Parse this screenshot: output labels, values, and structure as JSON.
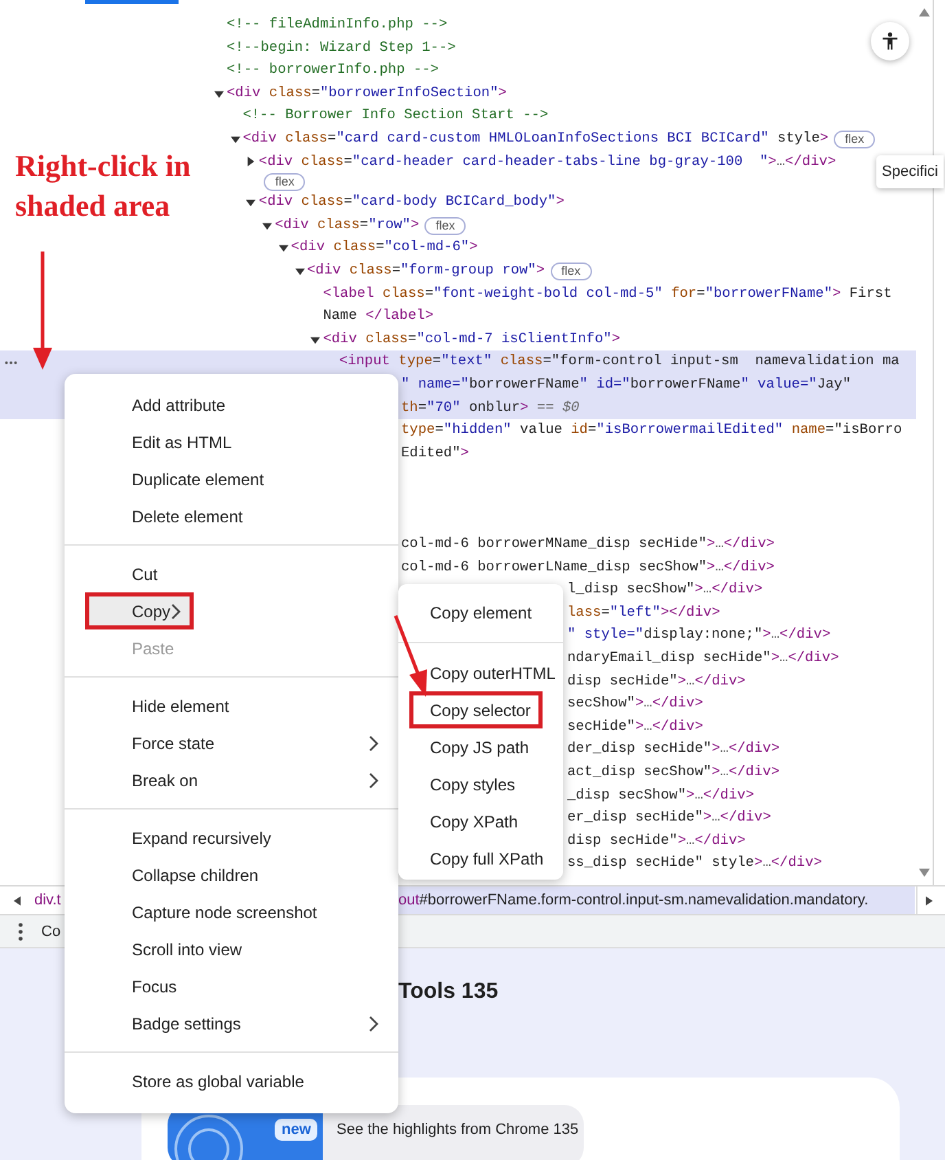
{
  "annotation": {
    "text": "Right-click in shaded area"
  },
  "code_tree": [
    {
      "kind": "comment",
      "selected": false,
      "lines": [
        {
          "text": "<!-- fileAdminInfo.php -->"
        }
      ]
    },
    {
      "kind": "comment",
      "selected": false,
      "lines": [
        {
          "text": "<!--begin: Wizard Step 1-->"
        }
      ]
    },
    {
      "kind": "comment",
      "selected": false,
      "lines": [
        {
          "text": "<!-- borrowerInfo.php -->"
        }
      ]
    },
    {
      "kind": "element",
      "selected": false,
      "expanded": true,
      "lines": [
        {
          "text": "<div class=\"borrowerInfoSection\">"
        }
      ],
      "children": [
        {
          "kind": "comment",
          "selected": false,
          "lines": [
            {
              "text": "<!-- Borrower Info Section Start -->"
            }
          ]
        },
        {
          "kind": "element",
          "selected": false,
          "expanded": true,
          "badge": "flex",
          "lines": [
            {
              "text": "<div class=\"card card-custom HMLOLoanInfoSections BCI BCICard\" style>"
            }
          ],
          "children": [
            {
              "kind": "element",
              "selected": false,
              "expanded": false,
              "badge": "flex",
              "lines": [
                {
                  "text": "<div class=\"card-header card-header-tabs-line bg-gray-100  \">…</div>"
                }
              ]
            },
            {
              "kind": "element",
              "selected": false,
              "expanded": true,
              "lines": [
                {
                  "text": "<div class=\"card-body BCICard_body\">"
                }
              ],
              "children": [
                {
                  "kind": "element",
                  "selected": false,
                  "expanded": true,
                  "badge": "flex",
                  "lines": [
                    {
                      "text": "<div class=\"row\">"
                    }
                  ],
                  "children": [
                    {
                      "kind": "element",
                      "selected": false,
                      "expanded": true,
                      "lines": [
                        {
                          "text": "<div class=\"col-md-6\">"
                        }
                      ],
                      "children": [
                        {
                          "kind": "element",
                          "selected": false,
                          "expanded": true,
                          "badge": "flex",
                          "lines": [
                            {
                              "text": "<div class=\"form-group row\">"
                            }
                          ],
                          "children": [
                            {
                              "kind": "leaf",
                              "selected": false,
                              "lines": [
                                {
                                  "text": "<label class=\"font-weight-bold col-md-5\" for=\"borrowerFName\"> First"
                                },
                                {
                                  "text": "Name </label>"
                                }
                              ]
                            },
                            {
                              "kind": "element",
                              "selected": false,
                              "expanded": true,
                              "lines": [
                                {
                                  "text": "<div class=\"col-md-7 isClientInfo\">"
                                }
                              ],
                              "children": [
                                {
                                  "kind": "leaf",
                                  "selected": true,
                                  "lines": [
                                    {
                                      "text": "<input type=\"text\" class=\"form-control input-sm  namevalidation ma"
                                    },
                                    {
                                      "text": "\" name=\"borrowerFName\" id=\"borrowerFName\" value=\"Jay\"",
                                      "kind": "after_menu"
                                    },
                                    {
                                      "text": "th=\"70\" onblur> == $0",
                                      "kind": "after_menu"
                                    }
                                  ]
                                },
                                {
                                  "kind": "leaf",
                                  "selected": false,
                                  "lines": [
                                    {
                                      "text": "type=\"hidden\" value id=\"isBorrowermailEdited\" name=\"isBorro",
                                      "kind": "after_menu"
                                    },
                                    {
                                      "text": "Edited\">",
                                      "kind": "after_menu"
                                    }
                                  ]
                                }
                              ]
                            }
                          ]
                        }
                      ]
                    },
                    {
                      "kind": "leaf",
                      "selected": false,
                      "lines": [
                        {
                          "text": "col-md-6 borrowerMName_disp secHide\">…</div>",
                          "kind": "after_menu"
                        }
                      ]
                    },
                    {
                      "kind": "leaf",
                      "selected": false,
                      "lines": [
                        {
                          "text": "col-md-6 borrowerLName_disp secShow\">…</div>",
                          "kind": "after_menu"
                        }
                      ]
                    },
                    {
                      "kind": "leaf",
                      "selected": false,
                      "lines": [
                        {
                          "text": "l_disp secShow\">…</div>",
                          "kind": "after_submenu"
                        }
                      ]
                    },
                    {
                      "kind": "leaf",
                      "selected": false,
                      "lines": [
                        {
                          "text": "lass=\"left\"></div>",
                          "kind": "after_submenu"
                        }
                      ]
                    },
                    {
                      "kind": "leaf",
                      "selected": false,
                      "lines": [
                        {
                          "text": "\" style=\"display:none;\">…</div>",
                          "kind": "after_submenu"
                        }
                      ]
                    },
                    {
                      "kind": "leaf",
                      "selected": false,
                      "lines": [
                        {
                          "text": "ndaryEmail_disp secHide\">…</div>",
                          "kind": "after_submenu"
                        }
                      ]
                    },
                    {
                      "kind": "leaf",
                      "selected": false,
                      "lines": [
                        {
                          "text": "disp secHide\">…</div>",
                          "kind": "after_submenu"
                        }
                      ]
                    },
                    {
                      "kind": "leaf",
                      "selected": false,
                      "lines": [
                        {
                          "text": "secShow\">…</div>",
                          "kind": "after_submenu"
                        }
                      ]
                    },
                    {
                      "kind": "leaf",
                      "selected": false,
                      "lines": [
                        {
                          "text": "secHide\">…</div>",
                          "kind": "after_submenu"
                        }
                      ]
                    },
                    {
                      "kind": "leaf",
                      "selected": false,
                      "lines": [
                        {
                          "text": "der_disp secHide\">…</div>",
                          "kind": "after_submenu"
                        }
                      ]
                    },
                    {
                      "kind": "leaf",
                      "selected": false,
                      "lines": [
                        {
                          "text": "act_disp secShow\">…</div>",
                          "kind": "after_submenu"
                        }
                      ]
                    },
                    {
                      "kind": "leaf",
                      "selected": false,
                      "lines": [
                        {
                          "text": "_disp secShow\">…</div>",
                          "kind": "after_submenu"
                        }
                      ]
                    },
                    {
                      "kind": "leaf",
                      "selected": false,
                      "lines": [
                        {
                          "text": "er_disp secHide\">…</div>",
                          "kind": "after_submenu"
                        }
                      ]
                    },
                    {
                      "kind": "leaf",
                      "selected": false,
                      "lines": [
                        {
                          "text": "disp secHide\">…</div>",
                          "kind": "after_submenu"
                        }
                      ]
                    },
                    {
                      "kind": "leaf",
                      "selected": false,
                      "lines": [
                        {
                          "text": "ss_disp secHide\" style>…</div>",
                          "kind": "after_submenu"
                        }
                      ]
                    }
                  ]
                }
              ]
            }
          ]
        }
      ]
    }
  ],
  "tooltip": {
    "text": "Specifici"
  },
  "breadcrumbs": [
    {
      "text": "div.t",
      "selected": false,
      "kind": "full"
    },
    {
      "text": "out#borrowerFName.form-control.input-sm.namevalidation.mandatory.",
      "selected": true,
      "kind": "after_menu"
    }
  ],
  "drawer": {
    "tab": "Co"
  },
  "whats_new": {
    "heading": {
      "text": "Tools 135",
      "kind": "after_menu"
    },
    "badge": "new",
    "highlight": "See the highlights from Chrome 135"
  },
  "menu": {
    "groups": [
      {
        "items": [
          {
            "label": "Add attribute",
            "selected": false,
            "disabled": false,
            "submenu": false,
            "callout": false
          },
          {
            "label": "Edit as HTML",
            "selected": false,
            "disabled": false,
            "submenu": false,
            "callout": false
          },
          {
            "label": "Duplicate element",
            "selected": false,
            "disabled": false,
            "submenu": false,
            "callout": false
          },
          {
            "label": "Delete element",
            "selected": false,
            "disabled": false,
            "submenu": false,
            "callout": false
          }
        ]
      },
      {
        "items": [
          {
            "label": "Cut",
            "selected": false,
            "disabled": false,
            "submenu": false,
            "callout": false
          },
          {
            "label": "Copy",
            "selected": true,
            "disabled": false,
            "submenu": true,
            "callout": true
          },
          {
            "label": "Paste",
            "selected": false,
            "disabled": true,
            "submenu": false,
            "callout": false
          }
        ]
      },
      {
        "items": [
          {
            "label": "Hide element",
            "selected": false,
            "disabled": false,
            "submenu": false,
            "callout": false
          },
          {
            "label": "Force state",
            "selected": false,
            "disabled": false,
            "submenu": true,
            "callout": false
          },
          {
            "label": "Break on",
            "selected": false,
            "disabled": false,
            "submenu": true,
            "callout": false
          }
        ]
      },
      {
        "items": [
          {
            "label": "Expand recursively",
            "selected": false,
            "disabled": false,
            "submenu": false,
            "callout": false
          },
          {
            "label": "Collapse children",
            "selected": false,
            "disabled": false,
            "submenu": false,
            "callout": false
          },
          {
            "label": "Capture node screenshot",
            "selected": false,
            "disabled": false,
            "submenu": false,
            "callout": false
          },
          {
            "label": "Scroll into view",
            "selected": false,
            "disabled": false,
            "submenu": false,
            "callout": false
          },
          {
            "label": "Focus",
            "selected": false,
            "disabled": false,
            "submenu": false,
            "callout": false
          },
          {
            "label": "Badge settings",
            "selected": false,
            "disabled": false,
            "submenu": true,
            "callout": false
          }
        ]
      },
      {
        "items": [
          {
            "label": "Store as global variable",
            "selected": false,
            "disabled": false,
            "submenu": false,
            "callout": false
          }
        ]
      }
    ]
  },
  "submenu": {
    "groups": [
      {
        "items": [
          {
            "label": "Copy element",
            "selected": false,
            "disabled": false,
            "callout": false
          }
        ]
      },
      {
        "items": [
          {
            "label": "Copy outerHTML",
            "selected": false,
            "disabled": false,
            "callout": false
          },
          {
            "label": "Copy selector",
            "selected": false,
            "disabled": false,
            "callout": true
          },
          {
            "label": "Copy JS path",
            "selected": false,
            "disabled": false,
            "callout": false
          },
          {
            "label": "Copy styles",
            "selected": false,
            "disabled": false,
            "callout": false
          },
          {
            "label": "Copy XPath",
            "selected": false,
            "disabled": false,
            "callout": false
          },
          {
            "label": "Copy full XPath",
            "selected": false,
            "disabled": false,
            "callout": false
          }
        ]
      }
    ]
  }
}
